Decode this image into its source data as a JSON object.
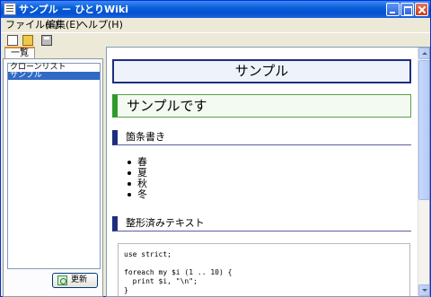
{
  "window": {
    "title": "サンプル － ひとりWiki"
  },
  "menu": {
    "items": [
      "ファイル(F)",
      "編集(E)",
      "ヘルプ(H)"
    ]
  },
  "toolbar": {
    "icons": [
      "new-file-icon",
      "open-folder-icon",
      "save-icon"
    ]
  },
  "sidebar": {
    "tab_label": "一覧",
    "items": [
      {
        "label": "クローンリスト",
        "selected": false
      },
      {
        "label": "サンプル",
        "selected": true
      }
    ],
    "update_button": "更新"
  },
  "content": {
    "h1": "サンプル",
    "h2": "サンプルです",
    "h3_list": "箇条書き",
    "bullets": [
      "春",
      "夏",
      "秋",
      "冬"
    ],
    "h3_pre": "整形済みテキスト",
    "pre_text": "use strict;\n\nforeach my $i (1 .. 10) {\n  print $i, \"\\n\";\n}"
  },
  "colors": {
    "title_bar": "#0a5fd8",
    "h1_border": "#1f2d80",
    "h2_accent": "#2f9a2c",
    "selection": "#316ac5"
  }
}
